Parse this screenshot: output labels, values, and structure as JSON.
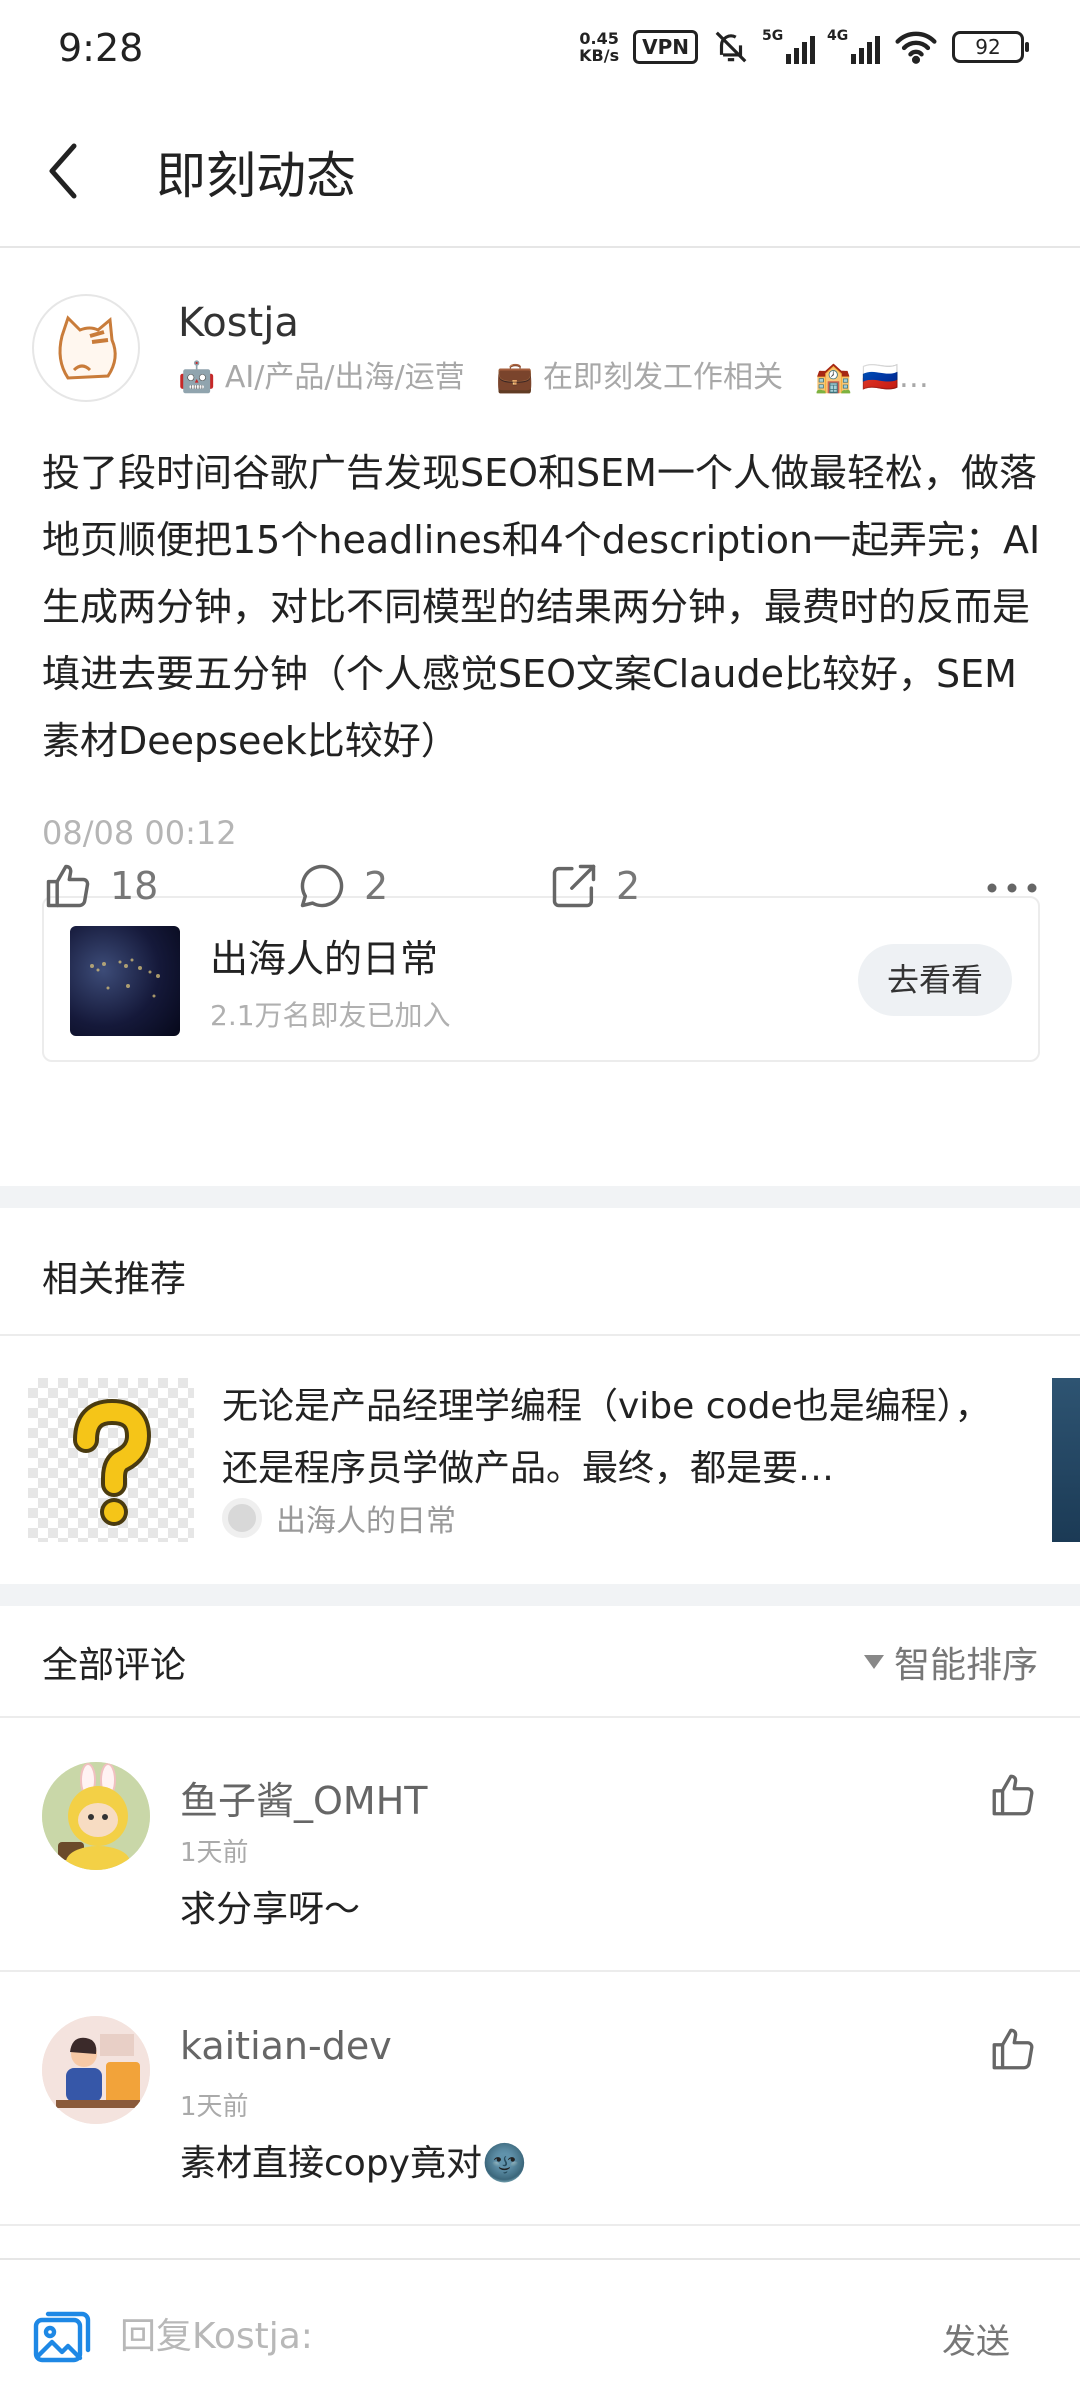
{
  "status_bar": {
    "time": "9:28",
    "net_speed_value": "0.45",
    "net_speed_unit": "KB/s",
    "vpn": "VPN",
    "sig1": "5G",
    "sig2": "4G",
    "battery": "92"
  },
  "header": {
    "title": "即刻动态"
  },
  "post": {
    "author": "Kostja",
    "tags": [
      "🤖 AI/产品/出海/运营",
      "💼 在即刻发工作相关",
      "🏫 🇷🇺…"
    ],
    "body": "投了段时间谷歌广告发现SEO和SEM一个人做最轻松，做落地页顺便把15个headlines和4个description一起弄完；AI生成两分钟，对比不同模型的结果两分钟，最费时的反而是填进去要五分钟（个人感觉SEO文案Claude比较好，SEM素材Deepseek比较好）",
    "time": "08/08 00:12",
    "circle": {
      "name": "出海人的日常",
      "members": "2.1万名即友已加入",
      "button": "去看看"
    },
    "actions": {
      "likes": "18",
      "comments": "2",
      "shares": "2"
    }
  },
  "related": {
    "title": "相关推荐",
    "item": {
      "text": "无论是产品经理学编程（vibe code也是编程），还是程序员学做产品。最终，都是要…",
      "source": "出海人的日常"
    }
  },
  "comments": {
    "title": "全部评论",
    "sort_label": "智能排序",
    "items": [
      {
        "name": "鱼子酱_OMHT",
        "time": "1天前",
        "text": "求分享呀～"
      },
      {
        "name": "kaitian-dev",
        "time": "1天前",
        "text": "素材直接copy竟对🌚"
      }
    ]
  },
  "reply": {
    "placeholder": "回复Kostja:",
    "send": "发送"
  },
  "colors": {
    "accent_blue": "#1e88e5",
    "divider": "#ececec",
    "section_gap": "#f1f3f5"
  }
}
